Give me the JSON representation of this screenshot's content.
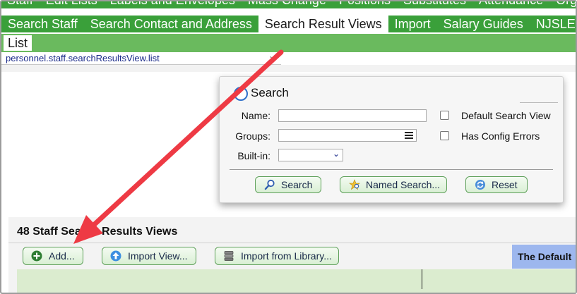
{
  "top_menu": [
    "Staff",
    "Edit Lists",
    "Labels and Envelopes",
    "Mass Change",
    "Positions",
    "Substitutes",
    "Attendance",
    "Organize"
  ],
  "tabs": [
    {
      "label": "Search Staff",
      "active": false
    },
    {
      "label": "Search Contact and Address",
      "active": false
    },
    {
      "label": "Search Result Views",
      "active": true
    },
    {
      "label": "Import",
      "active": false
    },
    {
      "label": "Salary Guides",
      "active": false
    },
    {
      "label": "NJSLEDS SM",
      "active": false
    }
  ],
  "subtab": {
    "label": "List"
  },
  "path": {
    "text": "personnel.staff.searchResultsView.list"
  },
  "search_panel": {
    "title": "Search",
    "name_label": "Name:",
    "groups_label": "Groups:",
    "builtin_label": "Built-in:",
    "name_value": "",
    "groups_value": "",
    "builtin_value": "",
    "default_view_label": "Default Search View",
    "config_errors_label": "Has Config Errors",
    "search_button": "Search",
    "named_search_button": "Named Search...",
    "reset_button": "Reset"
  },
  "results": {
    "title": "48 Staff Search Results Views",
    "add_button": "Add...",
    "import_view_button": "Import View...",
    "import_library_button": "Import from Library...",
    "default_label": "The Default"
  },
  "colors": {
    "menu_green": "#3aa03a",
    "subtab_green": "#6aba5e",
    "arrow_red": "#ee3a44",
    "button_border": "#5ea05a",
    "default_blue": "#9db7ee"
  }
}
